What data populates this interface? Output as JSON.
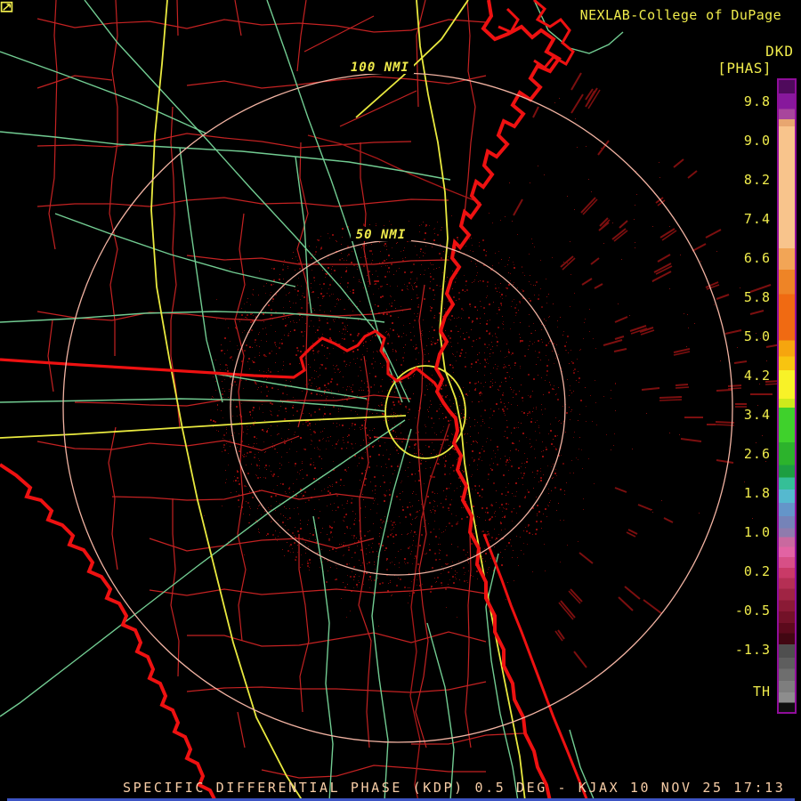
{
  "header": {
    "brand": "NEXLAB-College of DuPage",
    "logo_icon": "nexlab-logo-icon"
  },
  "product_panel": {
    "product_code": "DKD",
    "units": "[PHAS]",
    "threshold_label": "TH"
  },
  "colorbar": {
    "border_color": "#8f0d9a",
    "ticks": [
      "9.8",
      "9.0",
      "8.2",
      "7.4",
      "6.6",
      "5.8",
      "5.0",
      "4.2",
      "3.4",
      "2.6",
      "1.8",
      "1.0",
      "0.2",
      "-0.5",
      "-1.3"
    ],
    "stops": [
      [
        0,
        "#4f0a5c"
      ],
      [
        2.1,
        "#87189c"
      ],
      [
        4.6,
        "#a8469c"
      ],
      [
        6.2,
        "#e8a670"
      ],
      [
        7.3,
        "#f8c48c"
      ],
      [
        26.6,
        "#f2a556"
      ],
      [
        30,
        "#ee8426"
      ],
      [
        33.9,
        "#f06a12"
      ],
      [
        41.2,
        "#f6a50e"
      ],
      [
        43.7,
        "#f8c410"
      ],
      [
        45.9,
        "#f8f228"
      ],
      [
        50.4,
        "#cdea1c"
      ],
      [
        51.8,
        "#3fd12c"
      ],
      [
        57.3,
        "#2cb32c"
      ],
      [
        60.9,
        "#1d9e41"
      ],
      [
        62.9,
        "#35bf97"
      ],
      [
        64.8,
        "#55b9cf"
      ],
      [
        66.9,
        "#6495c9"
      ],
      [
        69,
        "#7583b8"
      ],
      [
        70.9,
        "#8f7bad"
      ],
      [
        72.3,
        "#c9699f"
      ],
      [
        73.9,
        "#e263a3"
      ],
      [
        75.5,
        "#d74f86"
      ],
      [
        77.2,
        "#c93a67"
      ],
      [
        78.8,
        "#b52f54"
      ],
      [
        80.5,
        "#a02444"
      ],
      [
        82.3,
        "#8a1a35"
      ],
      [
        84.1,
        "#731228"
      ],
      [
        85.9,
        "#5c0a1c"
      ],
      [
        87.5,
        "#420712"
      ],
      [
        89.3,
        "#4f4f4f"
      ],
      [
        91.4,
        "#5e5e5e"
      ],
      [
        93.2,
        "#6e6e6e"
      ],
      [
        95.1,
        "#7e7e7e"
      ],
      [
        96.9,
        "#8d8d8d"
      ],
      [
        98.5,
        "#0f0f0f"
      ],
      [
        100,
        "#000000"
      ]
    ]
  },
  "map": {
    "outer_ring_label": "100 NMI",
    "inner_ring_label": "50 NMI"
  },
  "status_bar": {
    "text": "SPECIFIC DIFFERENTIAL PHASE (KDP) 0.5 DEG - KJAX 10 NOV 25 17:13"
  },
  "colors": {
    "county_border": "#c42222",
    "coastline": "#ee1111",
    "interstate_road": "#e9e93f",
    "highway_road": "#72cc92",
    "range_ring": "#f2b3a2",
    "label_yellow": "#f0ec4c",
    "status_peach": "#f7cda6",
    "river": "#a81818",
    "clutter_speckle": [
      "#5c0505",
      "#6e0707",
      "#7f0a0a",
      "#8f0c0c"
    ],
    "clutter_streak": "#7c0f0f",
    "bottom_strip_blue": "#3d54c4"
  }
}
